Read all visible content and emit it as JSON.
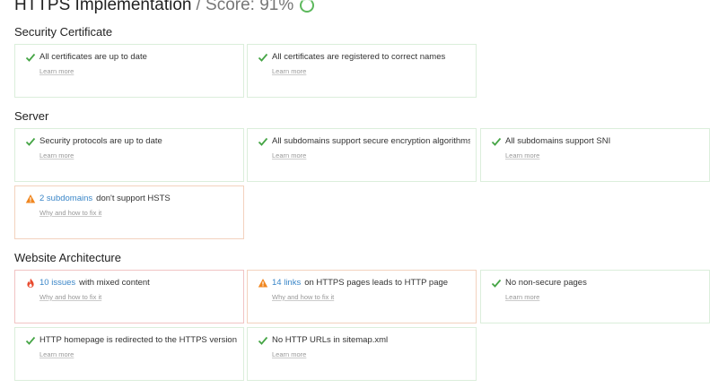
{
  "header": {
    "title": "HTTPS Implementation",
    "score_label": "/ Score: 91%",
    "score_ring_color": "#5cb85c"
  },
  "colors": {
    "ok": "#46a546",
    "warning": "#f0861f",
    "error": "#e84a2e",
    "link": "#3a86c8"
  },
  "sections": [
    {
      "title": "Security Certificate",
      "cards": [
        {
          "status": "ok",
          "icon": "check-icon",
          "text": "All certificates are up to date",
          "sub": "Learn more"
        },
        {
          "status": "ok",
          "icon": "check-icon",
          "text": "All certificates are registered to correct names",
          "sub": "Learn more"
        }
      ]
    },
    {
      "title": "Server",
      "cards": [
        {
          "status": "ok",
          "icon": "check-icon",
          "text": "Security protocols are up to date",
          "sub": "Learn more"
        },
        {
          "status": "ok",
          "icon": "check-icon",
          "text": "All subdomains support secure encryption algorithms",
          "sub": "Learn more"
        },
        {
          "status": "ok",
          "icon": "check-icon",
          "text": "All subdomains support SNI",
          "sub": "Learn more"
        },
        {
          "status": "warning",
          "icon": "warning-triangle-icon",
          "link": "2 subdomains",
          "text": "don't support HSTS",
          "sub": "Why and how to fix it"
        }
      ]
    },
    {
      "title": "Website Architecture",
      "cards": [
        {
          "status": "error",
          "icon": "flame-icon",
          "link": "10 issues",
          "text": "with mixed content",
          "sub": "Why and how to fix it"
        },
        {
          "status": "warning",
          "icon": "warning-triangle-icon",
          "link": "14 links",
          "text": "on HTTPS pages leads to HTTP page",
          "sub": "Why and how to fix it"
        },
        {
          "status": "ok",
          "icon": "check-icon",
          "text": "No non-secure pages",
          "sub": "Learn more"
        },
        {
          "status": "ok",
          "icon": "check-icon",
          "text": "HTTP homepage is redirected to the HTTPS version",
          "sub": "Learn more"
        },
        {
          "status": "ok",
          "icon": "check-icon",
          "text": "No HTTP URLs in sitemap.xml",
          "sub": "Learn more"
        }
      ]
    }
  ]
}
